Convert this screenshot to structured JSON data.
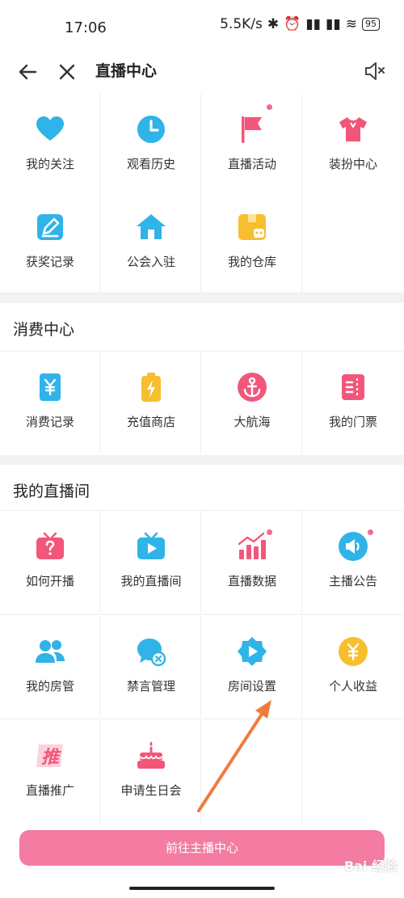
{
  "status_bar": {
    "time": "17:06",
    "net_speed": "5.5K/s",
    "battery": "95"
  },
  "nav": {
    "title": "直播中心"
  },
  "sections": {
    "top": {
      "items": [
        "我的关注",
        "观看历史",
        "直播活动",
        "装扮中心",
        "获奖记录",
        "公会入驻",
        "我的仓库"
      ]
    },
    "consume": {
      "title": "消费中心",
      "items": [
        "消费记录",
        "充值商店",
        "大航海",
        "我的门票"
      ]
    },
    "my_room": {
      "title": "我的直播间",
      "items": [
        "如何开播",
        "我的直播间",
        "直播数据",
        "主播公告",
        "我的房管",
        "禁言管理",
        "房间设置",
        "个人收益",
        "直播推广",
        "申请生日会"
      ]
    }
  },
  "icons": {
    "top": [
      "heart-icon",
      "clock-icon",
      "flag-icon",
      "shirt-icon",
      "edit-icon",
      "home-icon",
      "warehouse-icon"
    ],
    "consume": [
      "yen-card-icon",
      "battery-icon",
      "anchor-icon",
      "ticket-icon"
    ],
    "my_room": [
      "tv-question-icon",
      "tv-play-icon",
      "chart-bar-icon",
      "megaphone-icon",
      "users-icon",
      "mute-chat-icon",
      "play-settings-icon",
      "yen-coin-icon",
      "promote-icon",
      "cake-icon"
    ]
  },
  "colors": {
    "blue": "#30b3e8",
    "pink": "#f2577a",
    "yellow": "#f7bf2f",
    "primary_button": "#f47ba1",
    "annotation_arrow": "#f07b3f"
  },
  "footer": {
    "button": "前往主播中心",
    "watermark": "Bai 经验"
  }
}
